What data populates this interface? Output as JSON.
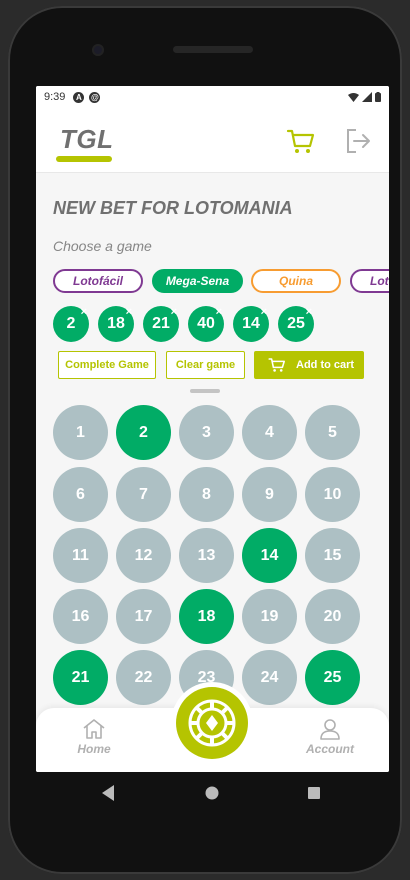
{
  "status_bar": {
    "time": "9:39",
    "badge_a": "A",
    "badge_b": "@"
  },
  "header": {
    "logo": "TGL"
  },
  "page": {
    "title": "NEW BET FOR LOTOMANIA",
    "subtitle": "Choose a game"
  },
  "games": [
    {
      "label": "Lotofácil",
      "color": "#7f3992",
      "selected": false
    },
    {
      "label": "Mega-Sena",
      "color": "#01ac66",
      "selected": true
    },
    {
      "label": "Quina",
      "color": "#f79c31",
      "selected": false
    },
    {
      "label": "Lotomania",
      "color": "#7f3992",
      "selected": false
    }
  ],
  "selected_numbers": [
    "2",
    "18",
    "21",
    "40",
    "14",
    "25"
  ],
  "actions": {
    "complete": "Complete Game",
    "clear": "Clear game",
    "add_to_cart": "Add to cart"
  },
  "grid": {
    "numbers": [
      "1",
      "2",
      "3",
      "4",
      "5",
      "6",
      "7",
      "8",
      "9",
      "10",
      "11",
      "12",
      "13",
      "14",
      "15",
      "16",
      "17",
      "18",
      "19",
      "20",
      "21",
      "22",
      "23",
      "24",
      "25"
    ],
    "selected": [
      "2",
      "14",
      "18",
      "21",
      "25"
    ]
  },
  "bottom_nav": {
    "home": "Home",
    "account": "Account"
  },
  "colors": {
    "accent": "#b5c401",
    "selected_green": "#01ac66",
    "number_gray": "#adc0c4",
    "text_gray": "#707070"
  }
}
